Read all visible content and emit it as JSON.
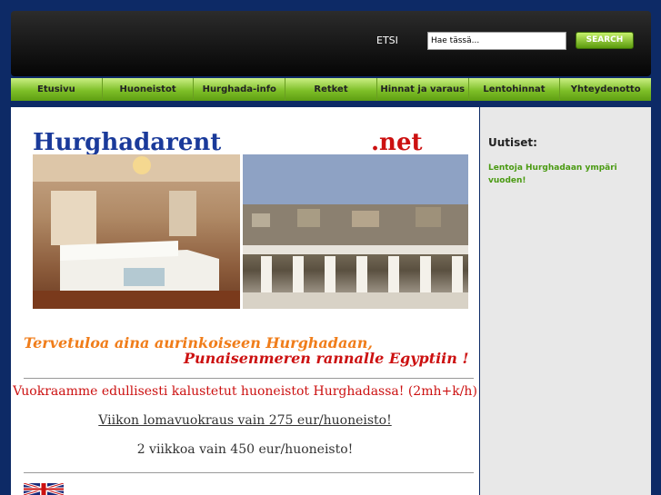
{
  "header": {
    "search_label": "ETSI",
    "search_input_value": "Hae tässä...",
    "search_button": "SEARCH"
  },
  "nav": [
    {
      "label": "Etusivu"
    },
    {
      "label": "Huoneistot"
    },
    {
      "label": "Hurghada-info"
    },
    {
      "label": "Retket"
    },
    {
      "label": "Hinnat ja varaus"
    },
    {
      "label": "Lentohinnat"
    },
    {
      "label": "Yhteydenotto"
    }
  ],
  "banner": {
    "title_part1": "Hurghadarent",
    "title_part2": ".net"
  },
  "main": {
    "welcome_line1": "Tervetuloa aina aurinkoiseen Hurghadaan,",
    "welcome_line2": "Punaisenmeren rannalle Egyptiin !",
    "offer_line1": "Vuokraamme edullisesti kalustetut huoneistot Hurghadassa!  (2mh+k/h)",
    "offer_line2": "Viikon lomavuokraus vain 275 eur/huoneisto!",
    "offer_line3": "2 viikkoa vain 450 eur/huoneisto!"
  },
  "sidebar": {
    "news_title": "Uutiset:",
    "news_link": "Lentoja Hurghadaan ympäri vuoden!"
  },
  "colors": {
    "page_bg": "#0d2a66",
    "nav_green": "#7ebf28",
    "orange": "#f07d1a",
    "red": "#cc1111",
    "link_green": "#4a9a12",
    "banner_blue": "#1a3a9a"
  }
}
